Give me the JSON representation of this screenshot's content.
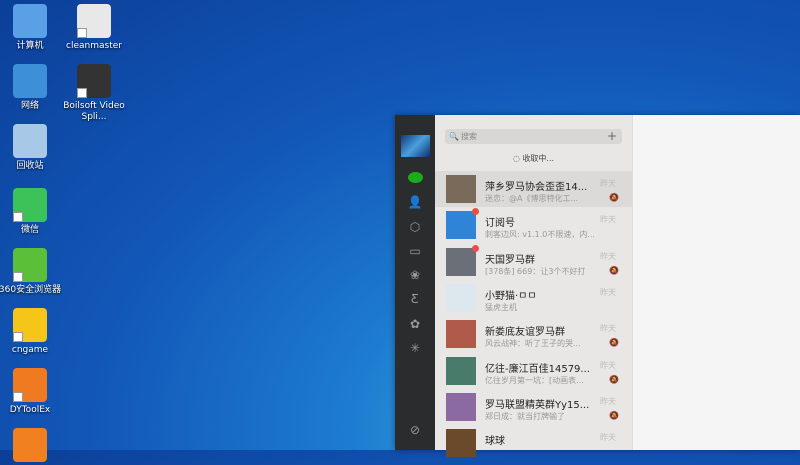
{
  "desktop": {
    "icons": [
      {
        "label": "计算机",
        "color": "#5aa0e6"
      },
      {
        "label": "cleanmaster",
        "color": "#e8e8e8"
      },
      {
        "label": "网络",
        "color": "#3d8fd8"
      },
      {
        "label": "Boilsoft Video Spli...",
        "color": "#333333"
      },
      {
        "label": "回收站",
        "color": "#a8c8e8"
      },
      {
        "label": "微信",
        "color": "#3bc35a"
      },
      {
        "label": "360安全浏览器",
        "color": "#5cbf3a"
      },
      {
        "label": "cngame",
        "color": "#f5c518"
      },
      {
        "label": "DYToolEx",
        "color": "#f07a20"
      },
      {
        "label": "",
        "color": "#f08020"
      }
    ]
  },
  "wechat": {
    "search_placeholder": "搜索",
    "add_label": "+",
    "receiving": "收取中...",
    "chats": [
      {
        "name": "萍乡罗马协会歪歪14...",
        "msg": "迷恋：@A《博思特化工...",
        "time": "昨天",
        "muted": true,
        "unread": false,
        "avatar": "#7a6a5a"
      },
      {
        "name": "订阅号",
        "msg": "刺客边风: v1.1.0不限速，内...",
        "time": "昨天",
        "muted": false,
        "unread": true,
        "avatar": "#2f84d8"
      },
      {
        "name": "天国罗马群",
        "msg": "[378条] 669：让3个不好打",
        "time": "昨天",
        "muted": true,
        "unread": true,
        "avatar": "#6b6f78"
      },
      {
        "name": "小野猫·ㅁㅁ",
        "msg": "猛虎主机",
        "time": "昨天",
        "muted": false,
        "unread": false,
        "avatar": "#dde7ee"
      },
      {
        "name": "新娄底友谊罗马群",
        "msg": "风云战神：听了王子的哭...",
        "time": "昨天",
        "muted": true,
        "unread": false,
        "avatar": "#b05a4a"
      },
      {
        "name": "亿往-廉江百佳14579...",
        "msg": "亿往岁月第一坑：[动画表...",
        "time": "昨天",
        "muted": true,
        "unread": false,
        "avatar": "#4a7a6a"
      },
      {
        "name": "罗马联盟精英群Yy15...",
        "msg": "郑日成：就当打牌输了",
        "time": "昨天",
        "muted": true,
        "unread": false,
        "avatar": "#8a6aa0"
      },
      {
        "name": "球球",
        "msg": "",
        "time": "昨天",
        "muted": false,
        "unread": false,
        "avatar": "#6a4a2a"
      }
    ]
  }
}
